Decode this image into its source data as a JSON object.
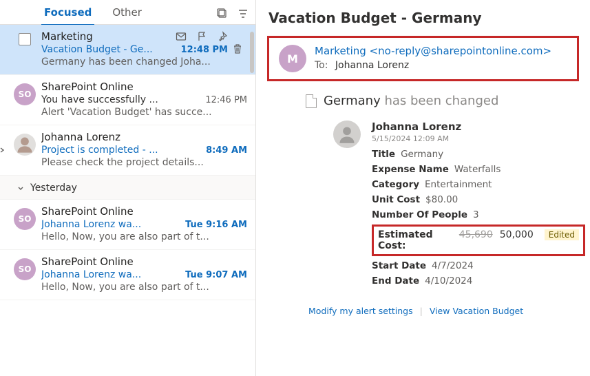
{
  "tabs": {
    "focused": "Focused",
    "other": "Other"
  },
  "messages": [
    {
      "sender": "Marketing",
      "subject": "Vacation Budget - Ge...",
      "time": "12:48 PM",
      "preview": "Germany has been changed Joha..."
    },
    {
      "avatar": "SO",
      "sender": "SharePoint Online",
      "subject": "You have successfully ...",
      "time": "12:46 PM",
      "preview": "Alert 'Vacation Budget' has succe..."
    },
    {
      "sender": "Johanna Lorenz",
      "subject": "Project is completed - ...",
      "time": "8:49 AM",
      "preview": "Please check the project details..."
    },
    {
      "avatar": "SO",
      "sender": "SharePoint Online",
      "subject": "Johanna Lorenz wa...",
      "time": "Tue 9:16 AM",
      "preview": "Hello, Now, you are also part of t..."
    },
    {
      "avatar": "SO",
      "sender": "SharePoint Online",
      "subject": "Johanna Lorenz wa...",
      "time": "Tue 9:07 AM",
      "preview": "Hello, Now, you are also part of t..."
    }
  ],
  "section": "Yesterday",
  "read": {
    "title": "Vacation Budget - Germany",
    "avatar": "M",
    "from_name": "Marketing",
    "from_email": "<no-reply@sharepointonline.com>",
    "to_label": "To:",
    "to_name": "Johanna Lorenz",
    "doc_name": "Germany",
    "doc_changed": "has been changed",
    "person": "Johanna Lorenz",
    "timestamp": "5/15/2024 12:09 AM",
    "fields": {
      "title_label": "Title",
      "title_value": "Germany",
      "expense_label": "Expense Name",
      "expense_value": "Waterfalls",
      "category_label": "Category",
      "category_value": "Entertainment",
      "unitcost_label": "Unit Cost",
      "unitcost_value": "$80.00",
      "people_label": "Number Of People",
      "people_value": "3",
      "estcost_label": "Estimated Cost:",
      "estcost_old": "45,690",
      "estcost_new": "50,000",
      "edited": "Edited",
      "start_label": "Start Date",
      "start_value": "4/7/2024",
      "end_label": "End Date",
      "end_value": "4/10/2024"
    },
    "footer": {
      "modify": "Modify my alert settings",
      "view": "View Vacation Budget"
    }
  }
}
